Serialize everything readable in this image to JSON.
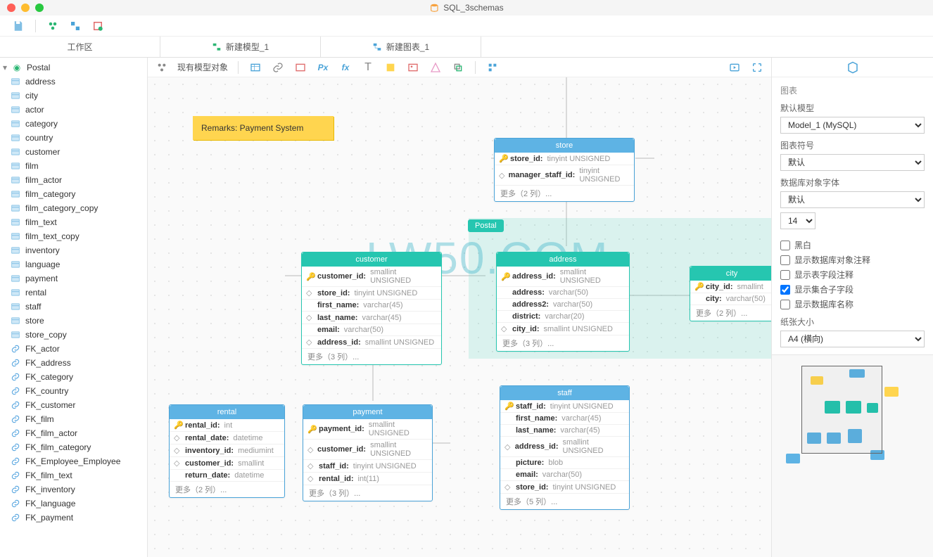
{
  "app_title": "SQL_3schemas",
  "tabs": [
    {
      "label": "工作区"
    },
    {
      "label": "新建模型_1"
    },
    {
      "label": "新建图表_1",
      "active": true
    }
  ],
  "canvas_toolbar_label": "现有模型对象",
  "sidebar_root": "Postal",
  "sidebar_tables": [
    "address",
    "city",
    "actor",
    "category",
    "country",
    "customer",
    "film",
    "film_actor",
    "film_category",
    "film_category_copy",
    "film_text",
    "film_text_copy",
    "inventory",
    "language",
    "payment",
    "rental",
    "staff",
    "store",
    "store_copy"
  ],
  "sidebar_fks": [
    "FK_actor",
    "FK_address",
    "FK_category",
    "FK_country",
    "FK_customer",
    "FK_film",
    "FK_film_actor",
    "FK_film_category",
    "FK_Employee_Employee",
    "FK_film_text",
    "FK_inventory",
    "FK_language",
    "FK_payment"
  ],
  "note_text": "Remarks: Payment System",
  "schema_tag": "Postal",
  "watermark": "LW50.COM",
  "tables": {
    "store": {
      "title": "store",
      "rows": [
        {
          "k": "pk",
          "name": "store_id:",
          "type": "tinyint UNSIGNED"
        },
        {
          "k": "fk",
          "name": "manager_staff_id:",
          "type": "tinyint UNSIGNED"
        }
      ],
      "more": "更多（2 列）..."
    },
    "customer": {
      "title": "customer",
      "rows": [
        {
          "k": "pk",
          "name": "customer_id:",
          "type": "smallint UNSIGNED"
        },
        {
          "k": "fk",
          "name": "store_id:",
          "type": "tinyint UNSIGNED"
        },
        {
          "k": "",
          "name": "first_name:",
          "type": "varchar(45)"
        },
        {
          "k": "fk",
          "name": "last_name:",
          "type": "varchar(45)"
        },
        {
          "k": "",
          "name": "email:",
          "type": "varchar(50)"
        },
        {
          "k": "fk",
          "name": "address_id:",
          "type": "smallint UNSIGNED"
        }
      ],
      "more": "更多（3 列）..."
    },
    "address": {
      "title": "address",
      "rows": [
        {
          "k": "pk",
          "name": "address_id:",
          "type": "smallint UNSIGNED"
        },
        {
          "k": "",
          "name": "address:",
          "type": "varchar(50)"
        },
        {
          "k": "",
          "name": "address2:",
          "type": "varchar(50)"
        },
        {
          "k": "",
          "name": "district:",
          "type": "varchar(20)"
        },
        {
          "k": "fk",
          "name": "city_id:",
          "type": "smallint UNSIGNED"
        }
      ],
      "more": "更多（3 列）..."
    },
    "city": {
      "title": "city",
      "rows": [
        {
          "k": "pk",
          "name": "city_id:",
          "type": "smallint"
        },
        {
          "k": "",
          "name": "city:",
          "type": "varchar(50)"
        }
      ],
      "more": "更多（2 列）..."
    },
    "rental": {
      "title": "rental",
      "rows": [
        {
          "k": "pk",
          "name": "rental_id:",
          "type": "int"
        },
        {
          "k": "fk",
          "name": "rental_date:",
          "type": "datetime"
        },
        {
          "k": "fk",
          "name": "inventory_id:",
          "type": "mediumint"
        },
        {
          "k": "fk",
          "name": "customer_id:",
          "type": "smallint"
        },
        {
          "k": "",
          "name": "return_date:",
          "type": "datetime"
        }
      ],
      "more": "更多（2 列）..."
    },
    "payment": {
      "title": "payment",
      "rows": [
        {
          "k": "pk",
          "name": "payment_id:",
          "type": "smallint UNSIGNED"
        },
        {
          "k": "fk",
          "name": "customer_id:",
          "type": "smallint UNSIGNED"
        },
        {
          "k": "fk",
          "name": "staff_id:",
          "type": "tinyint UNSIGNED"
        },
        {
          "k": "fk",
          "name": "rental_id:",
          "type": "int(11)"
        }
      ],
      "more": "更多（3 列）..."
    },
    "staff": {
      "title": "staff",
      "rows": [
        {
          "k": "pk",
          "name": "staff_id:",
          "type": "tinyint UNSIGNED"
        },
        {
          "k": "",
          "name": "first_name:",
          "type": "varchar(45)"
        },
        {
          "k": "",
          "name": "last_name:",
          "type": "varchar(45)"
        },
        {
          "k": "fk",
          "name": "address_id:",
          "type": "smallint UNSIGNED"
        },
        {
          "k": "",
          "name": "picture:",
          "type": "blob"
        },
        {
          "k": "",
          "name": "email:",
          "type": "varchar(50)"
        },
        {
          "k": "fk",
          "name": "store_id:",
          "type": "tinyint UNSIGNED"
        }
      ],
      "more": "更多（5 列）..."
    }
  },
  "rpanel": {
    "section_title": "图表",
    "default_model_label": "默认模型",
    "default_model_value": "Model_1 (MySQL)",
    "symbol_label": "图表符号",
    "symbol_value": "默认",
    "font_label": "数据库对象字体",
    "font_value": "默认",
    "font_size": "14",
    "cb_bw": "黑白",
    "cb_obj_comment": "显示数据库对象注释",
    "cb_field_comment": "显示表字段注释",
    "cb_sub_fields": "显示集合子字段",
    "cb_db_name": "显示数据库名称",
    "paper_label": "纸张大小",
    "paper_value": "A4 (横向)"
  }
}
